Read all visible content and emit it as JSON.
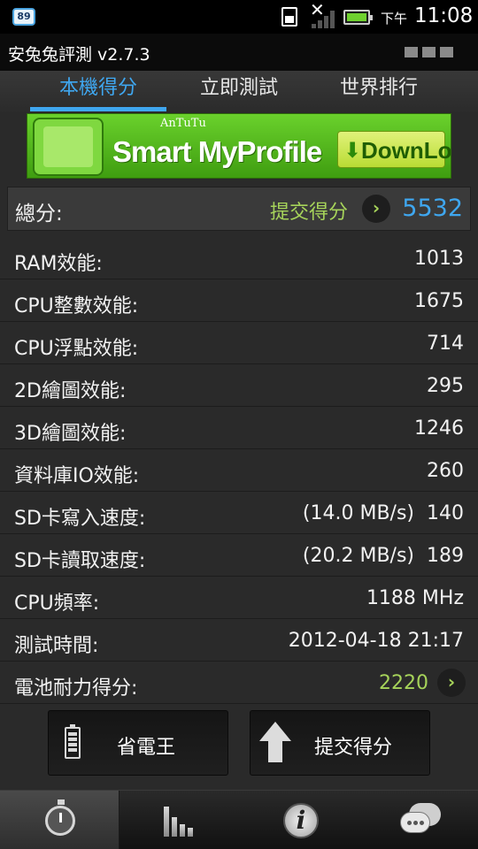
{
  "status_bar": {
    "notification_badge": "89",
    "am_pm": "下午",
    "time": "11:08",
    "icons": [
      "notification-badge-icon",
      "sim-card-icon",
      "signal-icon",
      "battery-icon"
    ]
  },
  "app": {
    "title": "安兔兔評測 v2.7.3"
  },
  "tabs": [
    {
      "label": "本機得分",
      "active": true
    },
    {
      "label": "立即測試",
      "active": false
    },
    {
      "label": "世界排行",
      "active": false
    }
  ],
  "banner": {
    "brand": "AnTuTu",
    "headline": "Smart MyProfile",
    "button_label": "DownLoad"
  },
  "total": {
    "label": "總分:",
    "submit_label": "提交得分",
    "value": "5532"
  },
  "scores": [
    {
      "label": "RAM效能:",
      "value": "1013"
    },
    {
      "label": "CPU整數效能:",
      "value": "1675"
    },
    {
      "label": "CPU浮點效能:",
      "value": "714"
    },
    {
      "label": "2D繪圖效能:",
      "value": "295"
    },
    {
      "label": "3D繪圖效能:",
      "value": "1246"
    },
    {
      "label": "資料庫IO效能:",
      "value": "260"
    },
    {
      "label": "SD卡寫入速度:",
      "speed": "(14.0 MB/s)",
      "value": "140"
    },
    {
      "label": "SD卡讀取速度:",
      "speed": "(20.2 MB/s)",
      "value": "189"
    },
    {
      "label": "CPU頻率:",
      "value": "1188 MHz"
    },
    {
      "label": "測試時間:",
      "value": "2012-04-18 21:17"
    }
  ],
  "battery_score": {
    "label": "電池耐力得分:",
    "value": "2220"
  },
  "buttons": {
    "power_saver": "省電王",
    "submit_score": "提交得分"
  },
  "bottom_nav": [
    {
      "icon": "stopwatch-icon",
      "active": true
    },
    {
      "icon": "bar-chart-icon",
      "active": false
    },
    {
      "icon": "info-icon",
      "active": false
    },
    {
      "icon": "chat-icon",
      "active": false
    }
  ],
  "colors": {
    "accent_blue": "#3fa7f0",
    "accent_green": "#a6d35a",
    "background": "#2a2a2a"
  }
}
